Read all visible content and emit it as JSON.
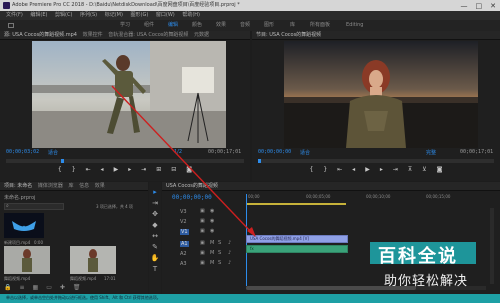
{
  "titlebar": {
    "title": "Adobe Premiere Pro CC 2018 - D:\\Baidu\\NetdiskDownload\\百度网盘项目\\百度经验项目.prproj *",
    "minimize": "—",
    "maximize": "□",
    "close": "✕"
  },
  "menubar": {
    "items": [
      "文件(F)",
      "编辑(E)",
      "剪辑(C)",
      "序列(S)",
      "标记(M)",
      "图形(G)",
      "窗口(W)",
      "帮助(H)"
    ]
  },
  "workspace": {
    "items": [
      "学习",
      "组件",
      "编辑",
      "颜色",
      "效果",
      "音频",
      "图形",
      "库",
      "所有面板",
      "Editing"
    ],
    "active_index": 2
  },
  "source_monitor": {
    "tabs": [
      "源: USA Cocos的舞蹈视频.mp4",
      "效果控件",
      "音轨混合器: USA Cocos的舞蹈视频",
      "元数据"
    ],
    "timecode_in": "00;00;03;02",
    "fit_label": "适合",
    "timecode_out": "00;00;17;01",
    "ratio_label": "1/2"
  },
  "program_monitor": {
    "tab": "节目: USA Cocos的舞蹈视频",
    "timecode_in": "00;00;00;00",
    "fit_label": "适合",
    "ratio_label": "完整",
    "timecode_out": "00;00;17;01"
  },
  "project": {
    "tabs": [
      "项目: 未命名",
      "媒体浏览器",
      "库",
      "信息",
      "效果"
    ],
    "project_name": "未命名.prproj",
    "item_count": "3 项已选择，共 4 项",
    "thumbs": [
      {
        "name": "新建项目.mp4",
        "duration": "0:00"
      },
      {
        "name": "舞蹈视频.mp4",
        "duration": "17:01"
      },
      {
        "name": "舞蹈视频.mp4",
        "duration": "17:01"
      }
    ]
  },
  "timeline": {
    "tab": "USA Cocos的舞蹈视频",
    "timecode": "00;00;00;00",
    "ruler": [
      "00;00",
      "00;00;05;00",
      "00;00;10;00",
      "00;00;15;00"
    ],
    "tracks": [
      "V3",
      "V2",
      "V1",
      "A1",
      "A2",
      "A3"
    ],
    "clip_v_label": "USA Cocos的舞蹈视频.mp4 [V]",
    "clip_a_label": "fx"
  },
  "statusbar": {
    "text": "单击以选择，或单击空白处并拖动以进行框选。使用 Shift、Alt 和 Ctrl 获得其他选项。"
  },
  "watermark": {
    "line1": "百科全说",
    "line2": "助你轻松解决"
  },
  "colors": {
    "accent": "#2d8ceb",
    "clip": "#8fa0e6",
    "teal": "#1ea0a5",
    "arrow": "#cc1f1f"
  }
}
